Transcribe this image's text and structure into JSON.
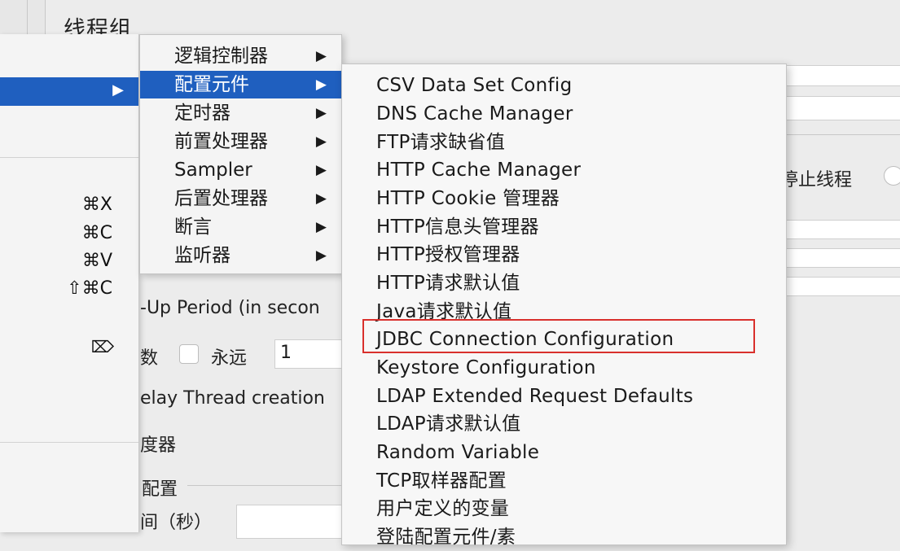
{
  "panel": {
    "title": "线程组",
    "stop_thread_label": "停止线程",
    "ramp_up_label": "-Up Period (in secon",
    "loop_label": "数",
    "forever_label": "永远",
    "loop_value": "1",
    "delay_label": "elay Thread creation",
    "scheduler_label": "度器",
    "config_label": "配置",
    "duration_label": "间（秒）"
  },
  "context_menu": {
    "shortcuts": [
      {
        "key": "⌘X"
      },
      {
        "key": "⌘C"
      },
      {
        "key": "⌘V"
      },
      {
        "key": "⇧⌘C"
      }
    ],
    "delete_icon": "⌦",
    "arrow": "▶"
  },
  "submenu": {
    "items": [
      {
        "label": "逻辑控制器",
        "arrow": "▶"
      },
      {
        "label": "配置元件",
        "arrow": "▶"
      },
      {
        "label": "定时器",
        "arrow": "▶"
      },
      {
        "label": "前置处理器",
        "arrow": "▶"
      },
      {
        "label": "Sampler",
        "arrow": "▶"
      },
      {
        "label": "后置处理器",
        "arrow": "▶"
      },
      {
        "label": "断言",
        "arrow": "▶"
      },
      {
        "label": "监听器",
        "arrow": "▶"
      }
    ]
  },
  "config_menu": {
    "items": [
      "CSV Data Set Config",
      "DNS Cache Manager",
      "FTP请求缺省值",
      "HTTP Cache Manager",
      "HTTP Cookie 管理器",
      "HTTP信息头管理器",
      "HTTP授权管理器",
      "HTTP请求默认值",
      "Java请求默认值",
      "JDBC Connection Configuration",
      "Keystore Configuration",
      "LDAP Extended Request Defaults",
      "LDAP请求默认值",
      "Random Variable",
      "TCP取样器配置",
      "用户定义的变量",
      "登陆配置元件/素"
    ],
    "highlighted": "JDBC Connection Configuration"
  },
  "colors": {
    "selection": "#1f5fbf",
    "highlight_box": "#d9302c"
  }
}
